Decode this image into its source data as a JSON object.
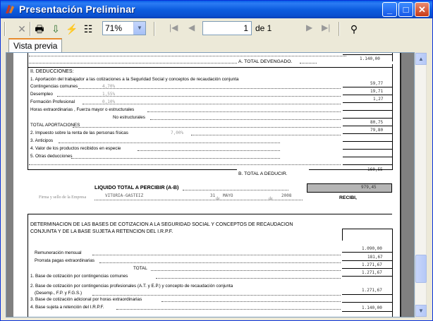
{
  "window": {
    "title": "Presentación Preliminar"
  },
  "toolbar": {
    "zoom_value": "71%",
    "page_value": "1",
    "of_label": "de 1"
  },
  "tabs": [
    "Vista previa"
  ],
  "doc": {
    "total_devengado_label": "A. TOTAL DEVENGADO.",
    "total_devengado_value": "1.140,00",
    "deducciones_title": "II. DEDUCCIONES:",
    "aport_title": "1. Aportación del trabajador a las cotizaciones a la Seguridad Social y conceptos de recaudación conjunta",
    "contingencias": "Contingencias comunes",
    "contingencias_pct": "4,70%",
    "contingencias_val": "59,77",
    "desempleo": "Desempleo",
    "desempleo_pct": "1,55%",
    "desempleo_val": "19,71",
    "formacion": "Formación Profesional",
    "formacion_pct": "0,10%",
    "formacion_val": "1,27",
    "horas_extra": "Horas extraordinarias , Fuerza mayor o estructurales",
    "no_estructurales": "No estructurales",
    "total_aport": "TOTAL APORTACIONES",
    "total_aport_val": "80,75",
    "irpf": "2. Impuesto sobre la renta de las personas físicas",
    "irpf_pct": "7,00%",
    "irpf_val": "79,80",
    "anticipos": "3. Anticipos",
    "especie": "4. Valor de los productos recibidos en especie",
    "otras": "5. Otras deducciones",
    "total_deducir_val": "160,55",
    "total_deducir_label": "B. TOTAL A DEDUCIR.",
    "liquido_label": "LIQUIDO TOTAL A PERCIBIR  (A-B)",
    "liquido_val": "979,45",
    "firma": "Firma y sello de la Empresa",
    "city": "VITORIA-GASTEIZ",
    "day": "31",
    "de1": "de",
    "month": "MAYO",
    "de2": "de",
    "year": "2008",
    "recibi": "RECIBI,",
    "det_title_1": "DETERMINACION DE LAS BASES DE COTIZACION A LA SEGURIDAD SOCIAL Y CONCEPTOS DE RECAUDACION",
    "det_title_2": "CONJUNTA Y DE LA BASE SUJETA A RETENCION DEL I.R.P.F.",
    "remun": "Remuneración mensual",
    "remun_val": "1.090,00",
    "prorrata": "Prorrata pagas extraordinarias",
    "prorrata_val": "181,67",
    "total": "TOTAL",
    "total_val": "1.271,67",
    "base1": "1. Base de cotización por contingencias comunes",
    "base1_val": "1.271,67",
    "base2a": "2. Base de cotización por contingencias profesionales (A.T. y E.P.) y concepto de recaudación conjunta",
    "base2b": "(Desemp., F.P. y F.G.S.)",
    "base2_val": "1.271,67",
    "base3": "3. Base de cotización adicional por horas extraordinarias",
    "base4": "4. Base sujeta a retención del I.R.P.F.",
    "base4_val": "1.140,00"
  }
}
